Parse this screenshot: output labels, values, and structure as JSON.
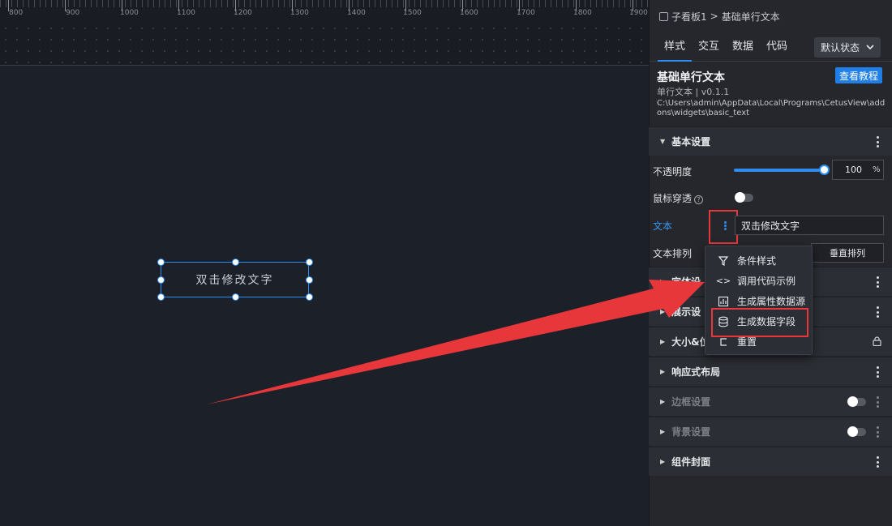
{
  "canvas": {
    "ruler_labels": [
      "800",
      "900",
      "1000",
      "1100",
      "1200",
      "1300",
      "1400",
      "1500",
      "1600",
      "1700",
      "1800",
      "1900"
    ],
    "widget_text": "双击修改文字"
  },
  "panel": {
    "breadcrumb": {
      "parent": "子看板1",
      "separator": ">",
      "current": "基础单行文本"
    },
    "tabs": [
      "样式",
      "交互",
      "数据",
      "代码"
    ],
    "state_select": "默认状态",
    "component": {
      "title": "基础单行文本",
      "subtitle": "单行文本 | v0.1.1",
      "path": "C:\\Users\\admin\\AppData\\Local\\Programs\\CetusView\\addons\\widgets\\basic_text",
      "tutorial_button": "查看教程"
    },
    "basic_settings": {
      "header": "基本设置",
      "opacity_label": "不透明度",
      "opacity_value": "100",
      "opacity_unit": "%",
      "opacity_level": 1.0,
      "mouse_through_label": "鼠标穿透",
      "text_label": "文本",
      "text_value": "双击修改文字",
      "text_align_label": "文本排列",
      "vertical_button": "垂直排列"
    },
    "sections": [
      {
        "label": "字体设置",
        "visible_label": "字体设",
        "dim": false
      },
      {
        "label": "展示设置",
        "visible_label": "展示设",
        "dim": false
      },
      {
        "label": "大小&位置",
        "visible_label": "大小&位",
        "dim": false
      },
      {
        "label": "响应式布局",
        "visible_label": "响应式布局",
        "dim": false
      },
      {
        "label": "边框设置",
        "visible_label": "边框设置",
        "dim": true
      },
      {
        "label": "背景设置",
        "visible_label": "背景设置",
        "dim": true
      },
      {
        "label": "组件封面",
        "visible_label": "组件封面",
        "dim": false
      }
    ]
  },
  "context_menu": {
    "items": [
      {
        "label": "条件样式",
        "icon": "filter-icon"
      },
      {
        "label": "调用代码示例",
        "icon": "code-icon"
      },
      {
        "label": "生成属性数据源",
        "icon": "chart-icon"
      },
      {
        "label": "生成数据字段",
        "icon": "database-icon"
      },
      {
        "label": "重置",
        "icon": "reset-icon"
      }
    ]
  },
  "colors": {
    "accent": "#2f8df0",
    "highlight": "#e8373b",
    "panel_bg": "#25272c",
    "canvas_bg": "#1c2129"
  }
}
